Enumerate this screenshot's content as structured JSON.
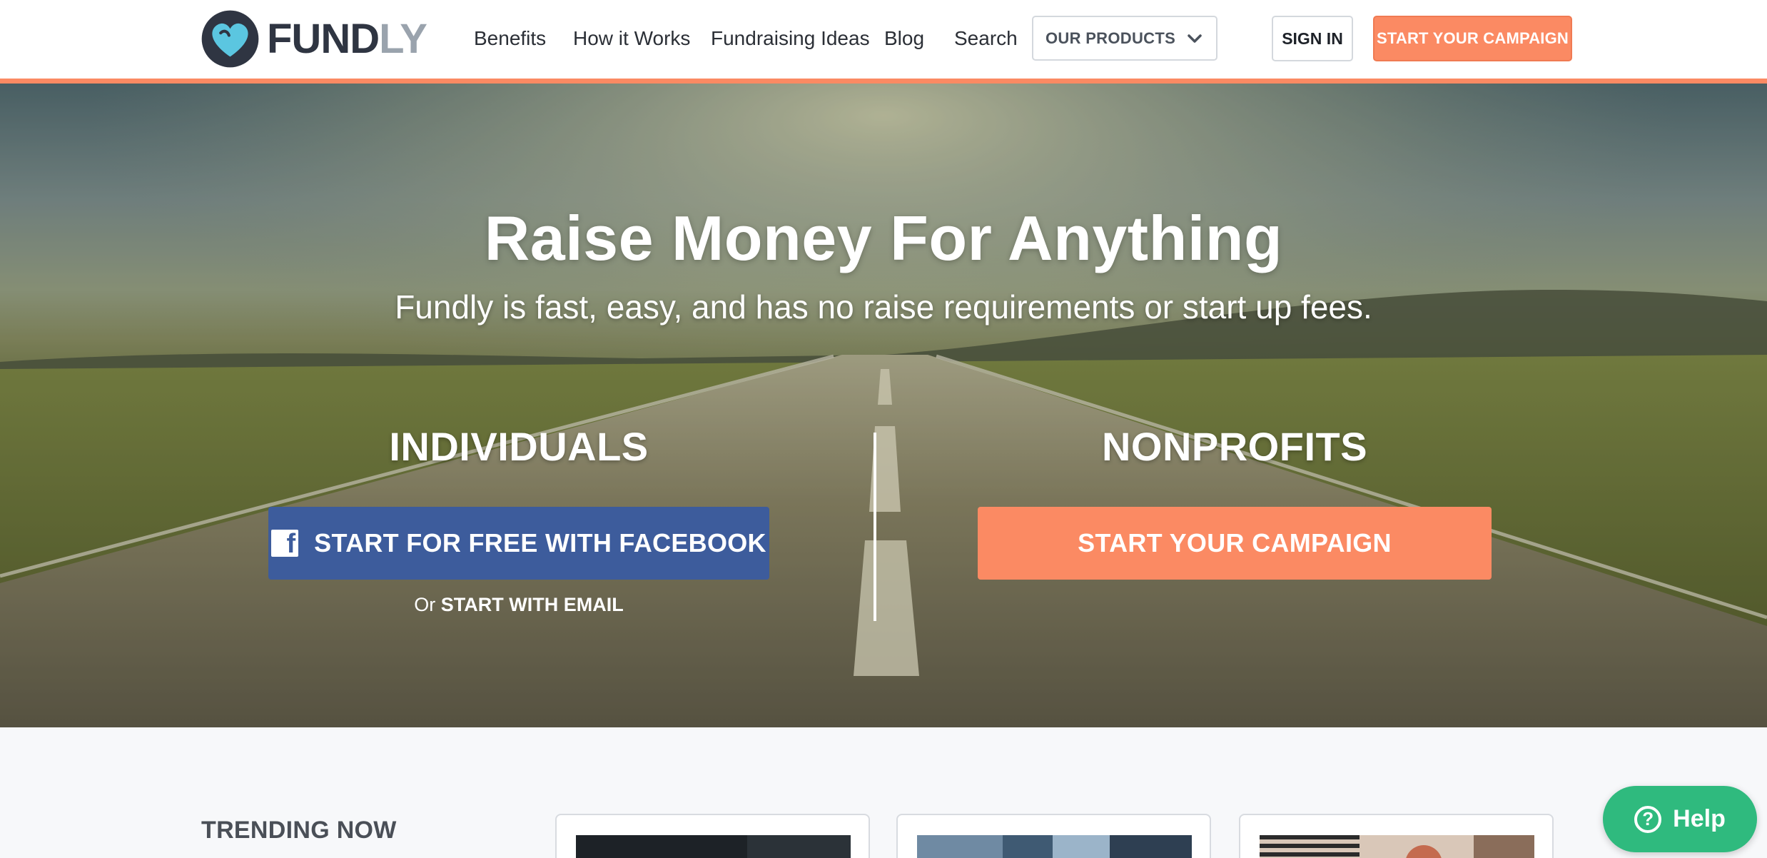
{
  "header": {
    "logo": {
      "text_main": "FUND",
      "text_accent": "LY",
      "icon": "heart-logo-icon"
    },
    "nav": [
      {
        "label": "Benefits"
      },
      {
        "label": "How it Works"
      },
      {
        "label": "Fundraising Ideas"
      },
      {
        "label": "Blog"
      },
      {
        "label": "Search"
      }
    ],
    "products_dropdown": {
      "label": "OUR PRODUCTS",
      "icon": "chevron-down-icon"
    },
    "sign_in_label": "SIGN IN",
    "start_campaign_label": "START YOUR CAMPAIGN"
  },
  "hero": {
    "title": "Raise Money For Anything",
    "subtitle": "Fundly is fast, easy, and has no raise requirements or start up fees.",
    "individuals": {
      "heading": "INDIVIDUALS",
      "facebook_button": "START FOR FREE WITH FACEBOOK",
      "email_prefix": "Or",
      "email_link": "START WITH EMAIL"
    },
    "nonprofits": {
      "heading": "NONPROFITS",
      "campaign_button": "START YOUR CAMPAIGN"
    }
  },
  "trending": {
    "title": "TRENDING NOW"
  },
  "help_widget": {
    "label": "Help",
    "icon": "question-icon"
  },
  "colors": {
    "accent": "#fb8a63",
    "facebook": "#3d5c9c",
    "help": "#2fba7e",
    "logo_dark": "#2f3542",
    "logo_heart": "#5bc6e0"
  }
}
